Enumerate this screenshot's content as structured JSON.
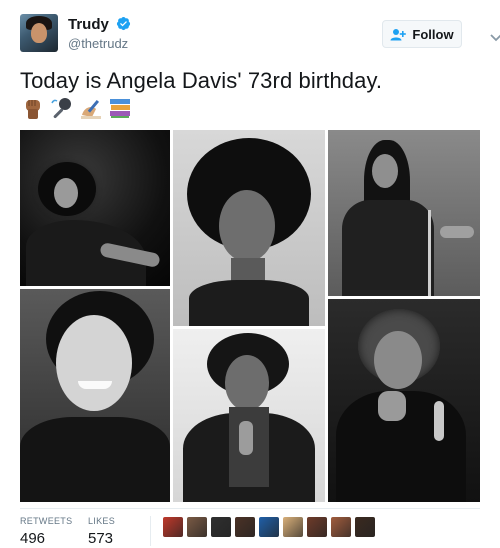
{
  "user": {
    "display_name": "Trudy",
    "handle": "@thetrudz",
    "follow_label": "Follow"
  },
  "tweet": {
    "text": "Today is Angela Davis' 73rd birthday.",
    "emojis": [
      "raised-fist-emoji",
      "microphone-emoji",
      "writing-hand-emoji",
      "books-emoji"
    ]
  },
  "photos": [
    {
      "name": "photo-1"
    },
    {
      "name": "photo-2"
    },
    {
      "name": "photo-3"
    },
    {
      "name": "photo-4"
    },
    {
      "name": "photo-5"
    },
    {
      "name": "photo-6"
    }
  ],
  "stats": {
    "retweets_label": "RETWEETS",
    "retweets_value": "496",
    "likes_label": "LIKES",
    "likes_value": "573"
  },
  "likers": {
    "count_shown": 9,
    "colors": [
      "#c0392b",
      "#7a5a44",
      "#2f2f2f",
      "#4b3226",
      "#1f5fa8",
      "#d9b07a",
      "#6e3b2a",
      "#a15c3d",
      "#3b2a20"
    ]
  }
}
